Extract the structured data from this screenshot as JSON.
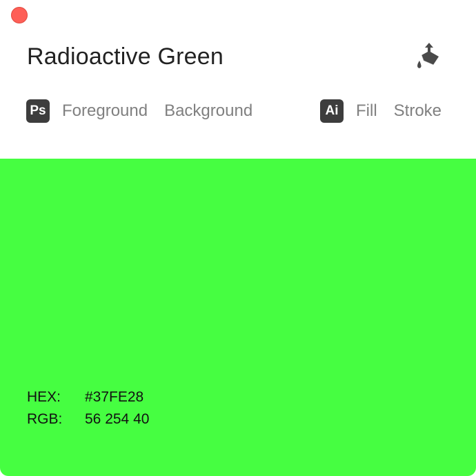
{
  "window": {
    "close_button": "close"
  },
  "color": {
    "name": "Radioactive Green",
    "hex_label": "HEX:",
    "hex_value": "#37FE28",
    "rgb_label": "RGB:",
    "rgb_value": "56 254 40",
    "swatch_color": "#46FE41"
  },
  "toolbar": {
    "paint_icon": "paint-bucket-export-icon"
  },
  "photoshop": {
    "badge": "Ps",
    "foreground_label": "Foreground",
    "background_label": "Background"
  },
  "illustrator": {
    "badge": "Ai",
    "fill_label": "Fill",
    "stroke_label": "Stroke"
  }
}
